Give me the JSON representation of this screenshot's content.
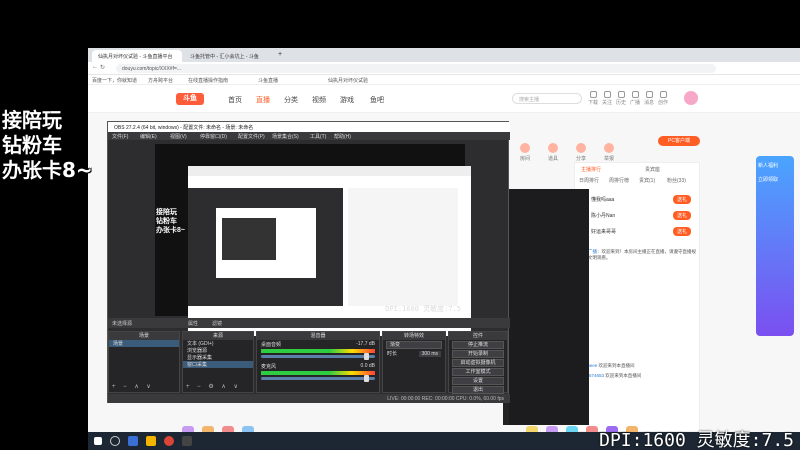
{
  "overlay": {
    "left_line1": "接陪玩",
    "left_line2": "钻粉车",
    "left_line3": "办张卡8~",
    "dpi_text": "DPI:1600 灵敏度:7.5"
  },
  "browser": {
    "tabs": [
      "仙执月对坏仪试验 - 斗鱼直播平台",
      "斗鱼托管中 - 汇小会坑上 - 斗鱼"
    ],
    "url": "douyu.com/topic/XXX#f=...",
    "bookmarks": [
      "百度一下，你就知道",
      "方舟跨平台",
      "在线直播操作指南",
      "斗鱼直播",
      "仙执月对坏仪试验"
    ],
    "colors": {
      "brand": "#ff5d23",
      "tabbar": "#dee1e6"
    }
  },
  "site": {
    "logo": "斗鱼",
    "nav": [
      "首页",
      "直播",
      "分类",
      "视频",
      "游戏",
      "鱼吧"
    ],
    "active_nav": "直播",
    "search_placeholder": "搜索主播",
    "header_icons": [
      "下载",
      "关注",
      "历史",
      "广播",
      "消息",
      "创作"
    ],
    "top_icons": [
      "房间",
      "道具",
      "分享",
      "举报"
    ],
    "pc_button": "PC客户端",
    "right_panel": {
      "tabs": [
        "主播排行",
        "贵宾座"
      ],
      "subtabs": [
        "日周排行",
        "周排行榜",
        "贵宾(1)",
        "粉丝(33)"
      ],
      "users": [
        {
          "name": "懂我吗aaa",
          "button": "送礼"
        },
        {
          "name": "陈小丹Nan",
          "button": "送礼"
        },
        {
          "name": "好运来哥哥",
          "button": "送礼"
        }
      ],
      "chat": [
        {
          "user": "系统广播",
          "text": "欢迎来到！本房间主播正在直播，请遵守直播规范，文明观看。"
        },
        {
          "user": "Dunbeee",
          "text": "欢迎来到本直播间"
        },
        {
          "user": "1428574653",
          "text": "欢迎来到本直播间"
        }
      ]
    },
    "ad_panel": [
      "新人福利",
      "立即领取"
    ]
  },
  "obs": {
    "title": "OBS 27.2.4 (64 bit, windows) - 配置文件: 未命名 - 场景: 未命名",
    "menu": [
      "文件(F)",
      "编辑(E)",
      "视图(V)",
      "停靠窗口(D)",
      "配置文件(P)",
      "场景集合(S)",
      "工具(T)",
      "帮助(H)"
    ],
    "source_bar": "未选择源",
    "source_bar_actions": [
      "属性",
      "滤镜"
    ],
    "panels": {
      "scenes": {
        "title": "场景",
        "items": [
          "场景"
        ]
      },
      "sources": {
        "title": "来源",
        "items": [
          "文本 (GDI+)",
          "浏览器源",
          "显示器采集",
          "窗口采集"
        ]
      },
      "mixer": {
        "title": "混音器",
        "tracks": [
          {
            "name": "桌面音频",
            "db": "-17.7 dB"
          },
          {
            "name": "麦克风",
            "db": "0.0 dB"
          }
        ]
      },
      "transitions": {
        "title": "转场特效",
        "type": "渐变",
        "duration_label": "时长",
        "duration": "300 ms"
      },
      "controls": {
        "title": "控件",
        "buttons": [
          "停止推流",
          "开始录制",
          "启动虚拟摄像机",
          "工作室模式",
          "设置",
          "退出"
        ]
      }
    },
    "status": "LIVE: 00:00:00   REC: 00:00:00   CPU: 0.0%, 60.00 fps",
    "nested_dpi": "DPI:1600 灵敏度:7.5"
  },
  "taskbar": {
    "search": "搜索",
    "clock": ""
  }
}
